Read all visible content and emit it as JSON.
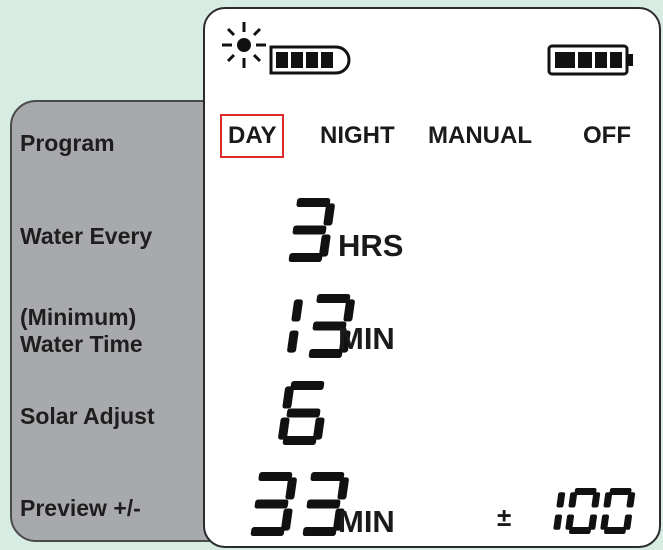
{
  "labels": {
    "program": "Program",
    "water_every": "Water Every",
    "water_time_line1": "(Minimum)",
    "water_time_line2": "Water Time",
    "solar_adjust": "Solar Adjust",
    "preview": "Preview +/-"
  },
  "modes": [
    {
      "label": "DAY",
      "selected": true
    },
    {
      "label": "NIGHT",
      "selected": false
    },
    {
      "label": "MANUAL",
      "selected": false
    },
    {
      "label": "OFF",
      "selected": false
    }
  ],
  "values": {
    "water_every": "3",
    "water_every_unit": "HRS",
    "water_time": "13",
    "water_time_unit": "MIN",
    "solar_adjust": "6",
    "preview": "33",
    "preview_unit": "MIN",
    "preview_sign": "±",
    "preview_percent": "100"
  },
  "icons": {
    "sun": "sun-icon",
    "solar_battery": "solar-battery-icon",
    "battery": "battery-icon"
  },
  "colors": {
    "background": "#d7ede3",
    "label_panel": "#a7a9ac",
    "selection": "#e02a2a"
  }
}
